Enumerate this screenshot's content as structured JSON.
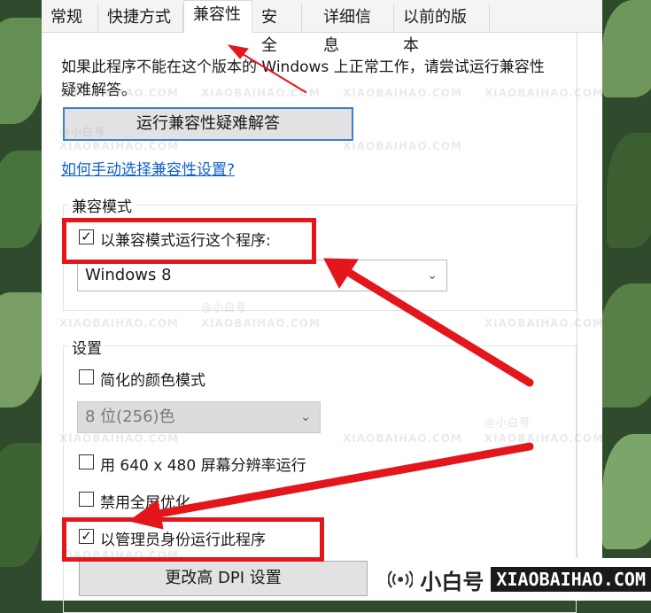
{
  "tabs": [
    {
      "label": "常规"
    },
    {
      "label": "快捷方式"
    },
    {
      "label": "兼容性"
    },
    {
      "label": "安全"
    },
    {
      "label": "详细信息"
    },
    {
      "label": "以前的版本"
    }
  ],
  "intro": {
    "line1": "如果此程序不能在这个版本的 Windows 上正常工作，请尝试运行兼容性",
    "line2": "疑难解答。"
  },
  "troubleshoot_button": "运行兼容性疑难解答",
  "manual_link": "如何手动选择兼容性设置?",
  "compat_mode": {
    "title": "兼容模式",
    "checkbox_label": "以兼容模式运行这个程序:",
    "checked": true,
    "os_select": "Windows 8"
  },
  "settings": {
    "title": "设置",
    "reduced_color": {
      "label": "简化的颜色模式",
      "checked": false
    },
    "color_select": "8 位(256)色",
    "res_640": {
      "label": "用 640 x 480 屏幕分辨率运行",
      "checked": false
    },
    "disable_fullscreen": {
      "label": "禁用全屏优化",
      "checked": false
    },
    "run_as_admin": {
      "label": "以管理员身份运行此程序",
      "checked": true
    },
    "dpi_button": "更改高 DPI 设置"
  },
  "watermark": {
    "handle": "@小白号",
    "site": "XIAOBAIHAO.COM",
    "badge_cn": "小白号",
    "badge_en": "XIAOBAIHAO.COM"
  },
  "colors": {
    "highlight": "#e3161c",
    "link": "#1060c8",
    "button_focus": "#3a80d2"
  }
}
